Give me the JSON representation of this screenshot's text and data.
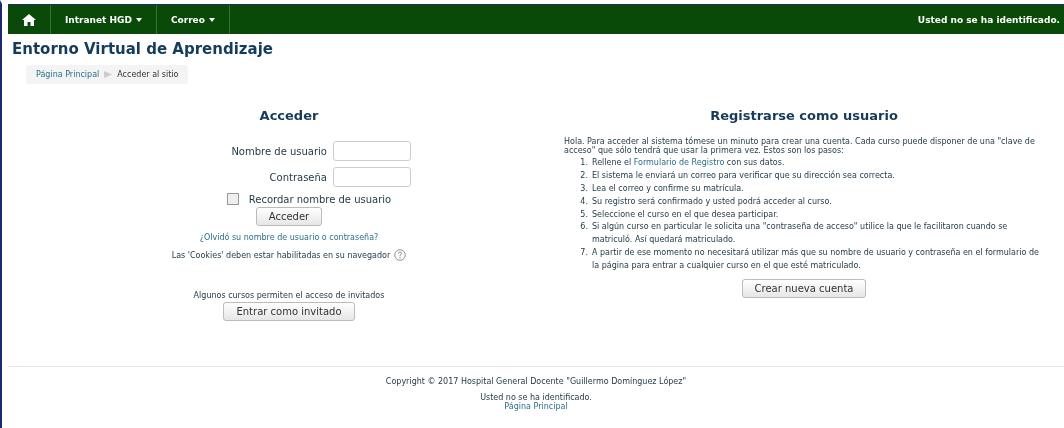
{
  "navbar": {
    "menus": [
      {
        "label": "Intranet HGD"
      },
      {
        "label": "Correo"
      }
    ],
    "login_status": "Usted no se ha identificado."
  },
  "page_title": "Entorno Virtual de Aprendizaje",
  "breadcrumb": [
    "Página Principal",
    "Acceder al sitio"
  ],
  "login": {
    "heading": "Acceder",
    "fields": [
      {
        "label": "Nombre de usuario"
      },
      {
        "label": "Contraseña"
      }
    ],
    "remember": {
      "label": "Recordar nombre de usuario",
      "checked": false
    },
    "submit": "Acceder",
    "forgot_link": "¿Olvidó su nombre de usuario o contraseña?",
    "cookies_note": "Las 'Cookies' deben estar habilitadas en su navegador",
    "guest_note": "Algunos cursos permiten el acceso de invitados",
    "guest_button": "Entrar como invitado"
  },
  "signup": {
    "heading": "Registrarse como usuario",
    "intro": "Hola. Para acceder al sistema tómese un minuto para crear una cuenta. Cada curso puede disponer de una \"clave de acceso\" que sólo tendrá que usar la primera vez. Estos son los pasos:",
    "steps": [
      {
        "number": "1.",
        "parts": [
          {
            "kind": "text",
            "text": "Rellene el "
          },
          {
            "kind": "link",
            "text": "Formulario de Registro"
          },
          {
            "kind": "text",
            "text": " con sus datos."
          }
        ]
      },
      {
        "number": "2.",
        "parts": [
          {
            "kind": "text",
            "text": "El sistema le enviará un correo para verificar que su dirección sea correcta."
          }
        ]
      },
      {
        "number": "3.",
        "parts": [
          {
            "kind": "text",
            "text": "Lea el correo y confirme su matrícula."
          }
        ]
      },
      {
        "number": "4.",
        "parts": [
          {
            "kind": "text",
            "text": "Su registro será confirmado y usted podrá acceder al curso."
          }
        ]
      },
      {
        "number": "5.",
        "parts": [
          {
            "kind": "text",
            "text": "Seleccione el curso en el que desea participar."
          }
        ]
      },
      {
        "number": "6.",
        "parts": [
          {
            "kind": "text",
            "text": "Si algún curso en particular le solicita una \"contraseña de acceso\" utilice la que le facilitaron cuando se matriculó. Así quedará matriculado."
          }
        ]
      },
      {
        "number": "7.",
        "parts": [
          {
            "kind": "text",
            "text": "A partir de ese momento no necesitará utilizar más que su nombre de usuario y contraseña en el formulario de la página para entrar a cualquier curso en el que esté matriculado."
          }
        ]
      }
    ],
    "button": "Crear nueva cuenta"
  },
  "footer": {
    "copyright": "Copyright © 2017 Hospital General Docente \"Guillermo Domínguez López\"",
    "login_status": "Usted no se ha identificado.",
    "home_link": "Página Principal"
  }
}
